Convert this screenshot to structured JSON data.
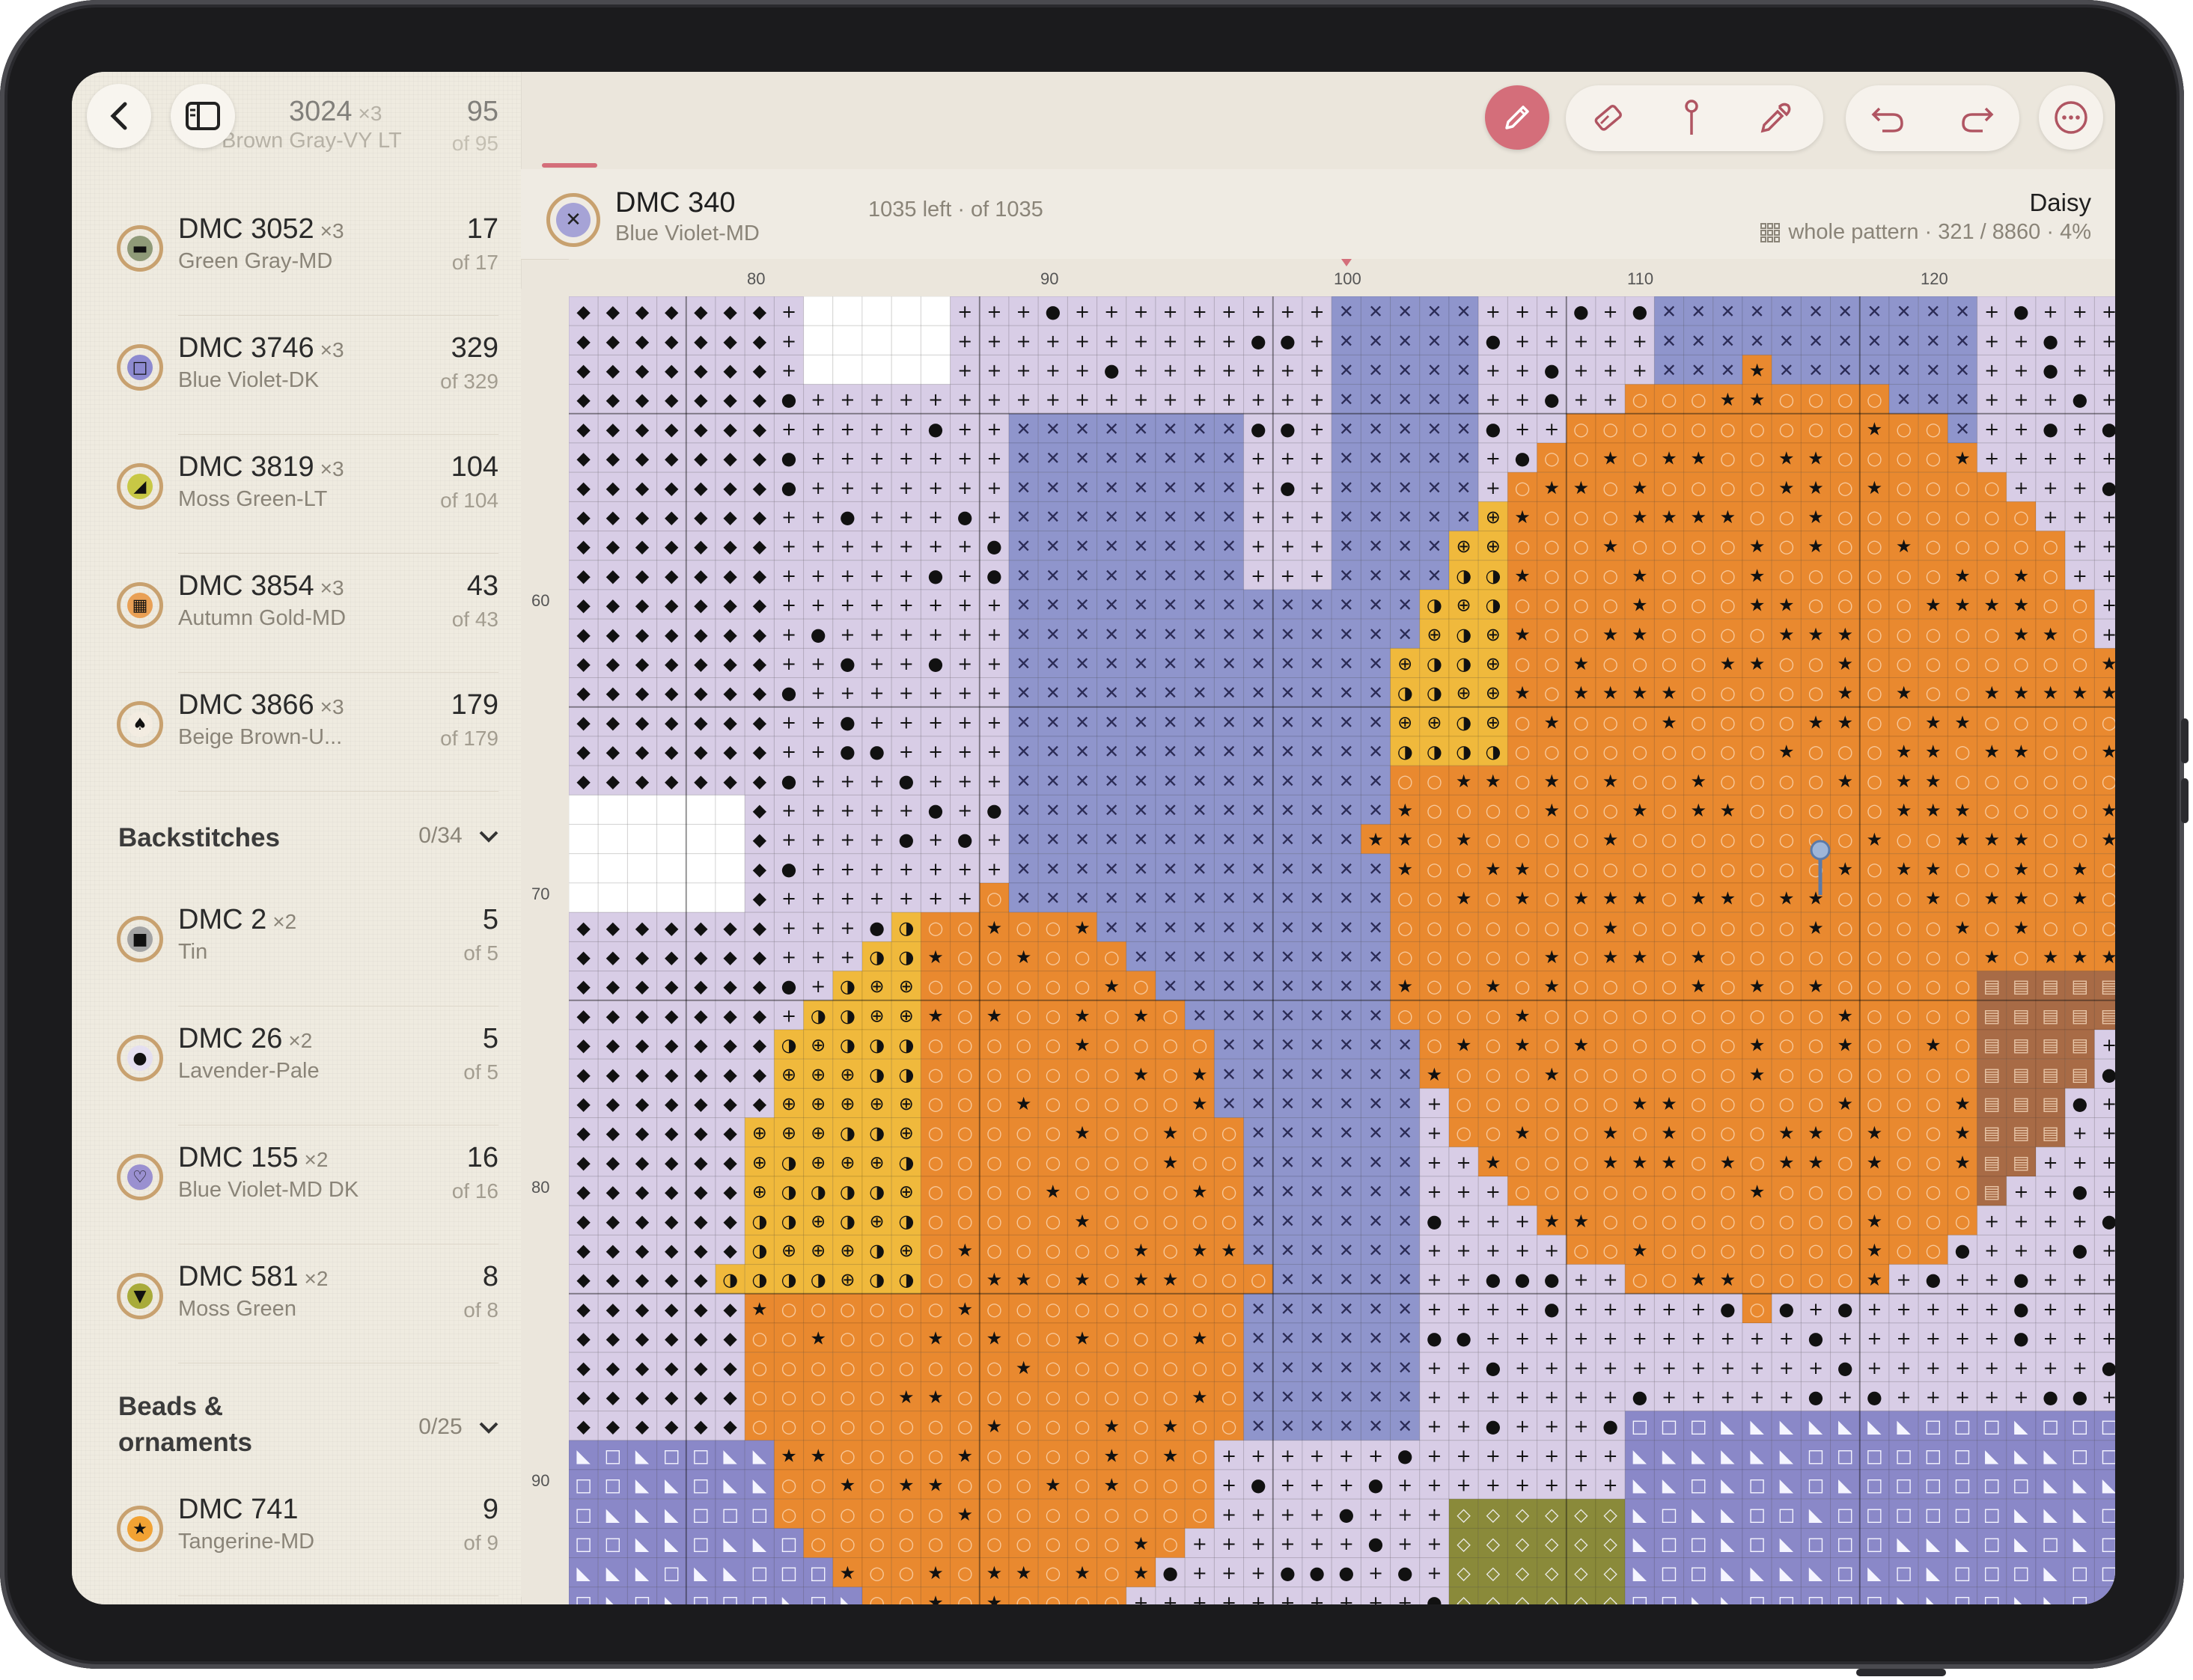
{
  "topbar": {
    "back_icon": "chevron-left-icon",
    "sidebar_toggle_icon": "sidebar-icon",
    "tools": [
      {
        "name": "pencil",
        "icon": "pencil-icon",
        "active": true
      },
      {
        "name": "eraser",
        "icon": "eraser-icon"
      },
      {
        "name": "pin",
        "icon": "pin-icon"
      },
      {
        "name": "eyedropper",
        "icon": "eyedropper-icon"
      },
      {
        "name": "undo",
        "icon": "undo-icon"
      },
      {
        "name": "redo",
        "icon": "redo-icon"
      },
      {
        "name": "more",
        "icon": "more-icon"
      }
    ],
    "accent_color": "#d46e7a"
  },
  "sidebar": {
    "partial_row": {
      "code": "3024",
      "mult": "×3",
      "name": "Brown Gray-VY LT",
      "count": "95",
      "of": "of 95"
    },
    "threads": [
      {
        "code": "DMC 3052",
        "mult": "×3",
        "name": "Green Gray-MD",
        "count": "17",
        "of": "of 17",
        "color": "#8f9a78",
        "symbol": "▬"
      },
      {
        "code": "DMC 3746",
        "mult": "×3",
        "name": "Blue Violet-DK",
        "count": "329",
        "of": "of 329",
        "color": "#8d8ad0",
        "symbol": "□"
      },
      {
        "code": "DMC 3819",
        "mult": "×3",
        "name": "Moss Green-LT",
        "count": "104",
        "of": "of 104",
        "color": "#c8c845",
        "symbol": "◢"
      },
      {
        "code": "DMC 3854",
        "mult": "×3",
        "name": "Autumn Gold-MD",
        "count": "43",
        "of": "of 43",
        "color": "#e9a055",
        "symbol": "▦"
      },
      {
        "code": "DMC 3866",
        "mult": "×3",
        "name": "Beige Brown-U...",
        "count": "179",
        "of": "of 179",
        "color": "#f3ece1",
        "symbol": "♠"
      }
    ],
    "backstitches": {
      "title": "Backstitches",
      "count": "0/34"
    },
    "backstitch_items": [
      {
        "code": "DMC 2",
        "mult": "×2",
        "name": "Tin",
        "count": "5",
        "of": "of 5",
        "color": "#a3a3a3",
        "symbol": "■"
      },
      {
        "code": "DMC 26",
        "mult": "×2",
        "name": "Lavender-Pale",
        "count": "5",
        "of": "of 5",
        "color": "#e4dff0",
        "symbol": "●"
      },
      {
        "code": "DMC 155",
        "mult": "×2",
        "name": "Blue Violet-MD DK",
        "count": "16",
        "of": "of 16",
        "color": "#9a90d0",
        "symbol": "♡"
      },
      {
        "code": "DMC 581",
        "mult": "×2",
        "name": "Moss Green",
        "count": "8",
        "of": "of 8",
        "color": "#a8ab3a",
        "symbol": "▼"
      }
    ],
    "beads": {
      "title": "Beads & ornaments",
      "count": "0/25"
    },
    "bead_items": [
      {
        "code": "DMC 741",
        "mult": "",
        "name": "Tangerine-MD",
        "count": "9",
        "of": "of 9",
        "color": "#f2a233",
        "symbol": "★"
      }
    ]
  },
  "header": {
    "thread_code": "DMC 340",
    "thread_name": "Blue Violet-MD",
    "left_text": "1035 left · of 1035",
    "pattern_name": "Daisy",
    "progress_text": "whole pattern · 321 / 8860 · 4%",
    "thread_color": "#a6a3d6",
    "thread_symbol": "✕"
  },
  "ruler": {
    "top": [
      "80",
      "90",
      "100",
      "110",
      "120"
    ],
    "left": [
      "60",
      "70",
      "80",
      "90"
    ]
  },
  "palette": {
    "lavender": "#d8cde6",
    "violet": "#8f95cc",
    "orange": "#e9892f",
    "gold": "#f0b93c",
    "brown": "#a86b46",
    "white": "#ffffff",
    "olive": "#8a8a3a",
    "purple_dk": "#8a88c8"
  }
}
